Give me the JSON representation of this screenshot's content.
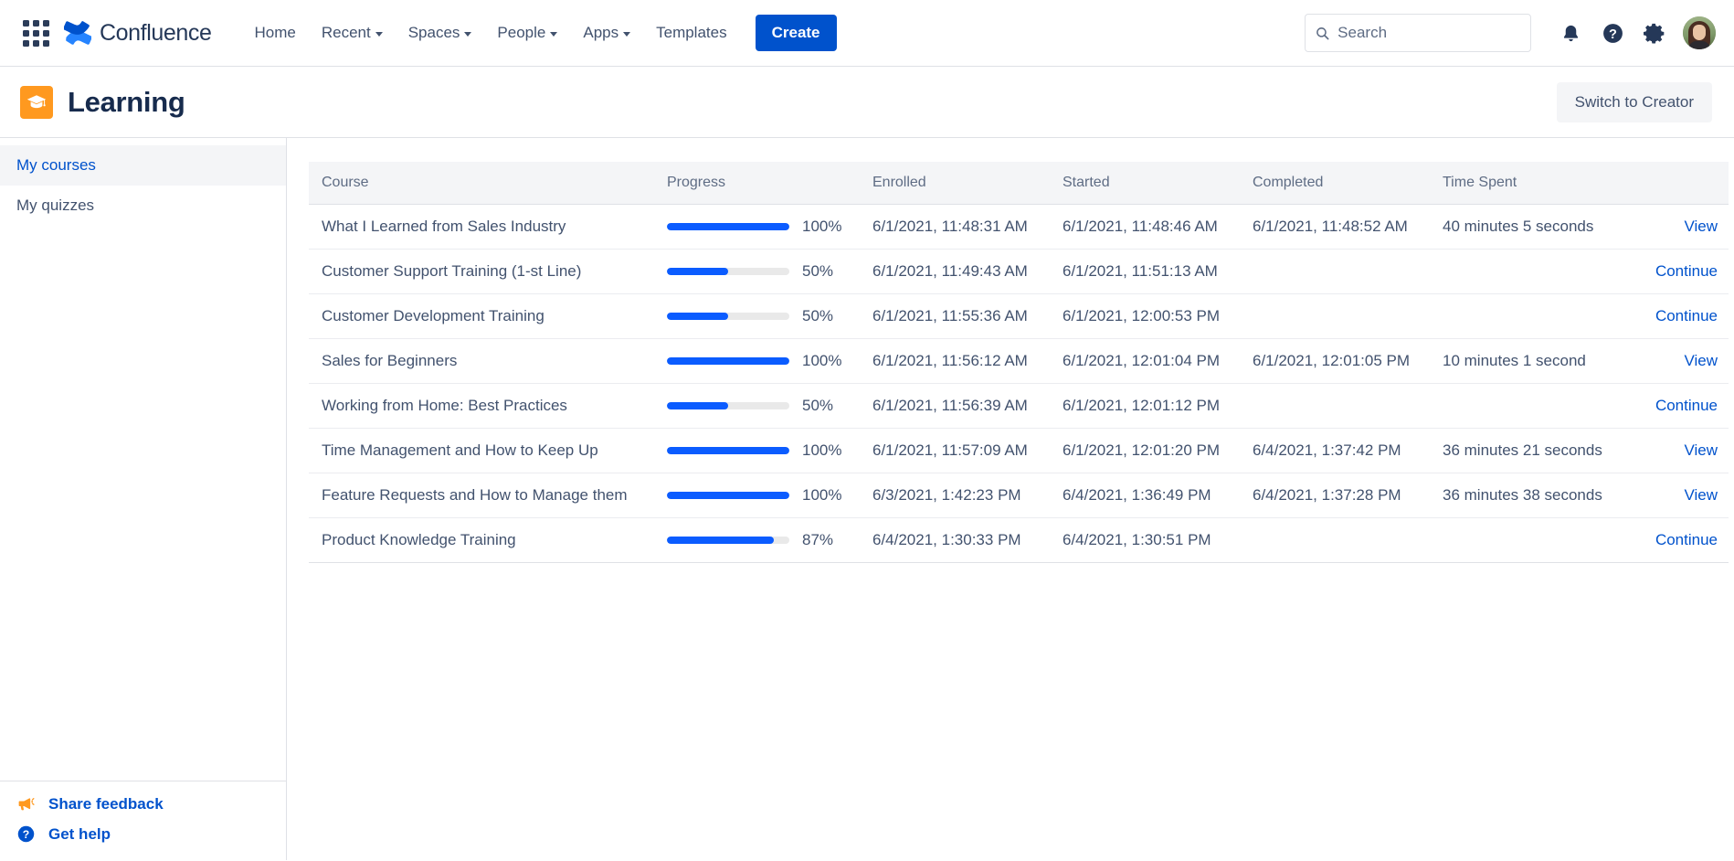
{
  "topnav": {
    "app_switcher_label": "App switcher",
    "brand": "Confluence",
    "links": [
      {
        "label": "Home",
        "has_caret": false
      },
      {
        "label": "Recent",
        "has_caret": true
      },
      {
        "label": "Spaces",
        "has_caret": true
      },
      {
        "label": "People",
        "has_caret": true
      },
      {
        "label": "Apps",
        "has_caret": true
      },
      {
        "label": "Templates",
        "has_caret": false
      }
    ],
    "create_label": "Create",
    "search": {
      "value": "",
      "placeholder": "Search"
    },
    "icons": [
      "notifications-icon",
      "help-icon",
      "settings-icon",
      "avatar"
    ]
  },
  "space": {
    "title": "Learning",
    "logo_icon": "graduation-cap-icon",
    "logo_color": "#ff991f",
    "switch_label": "Switch to Creator"
  },
  "sidebar": {
    "items": [
      {
        "label": "My courses",
        "active": true
      },
      {
        "label": "My quizzes",
        "active": false
      }
    ],
    "footer": [
      {
        "label": "Share feedback",
        "icon": "megaphone-icon"
      },
      {
        "label": "Get help",
        "icon": "question-circle-icon"
      }
    ]
  },
  "colors": {
    "accent": "#0052cc",
    "link": "#0052cc",
    "progress_fill": "#0b5cff",
    "progress_track": "#e9e9e9",
    "header_bg": "#f4f5f7",
    "text": "#42526e",
    "heading": "#172b4d",
    "orange": "#ff991f"
  },
  "table": {
    "columns": [
      "Course",
      "Progress",
      "Enrolled",
      "Started",
      "Completed",
      "Time Spent",
      ""
    ],
    "rows": [
      {
        "course": "What I Learned from Sales Industry",
        "progress": 100,
        "progress_label": "100%",
        "enrolled": "6/1/2021, 11:48:31 AM",
        "started": "6/1/2021, 11:48:46 AM",
        "completed": "6/1/2021, 11:48:52 AM",
        "time_spent": "40 minutes 5 seconds",
        "action": "View"
      },
      {
        "course": "Customer Support Training (1-st Line)",
        "progress": 50,
        "progress_label": "50%",
        "enrolled": "6/1/2021, 11:49:43 AM",
        "started": "6/1/2021, 11:51:13 AM",
        "completed": "",
        "time_spent": "",
        "action": "Continue"
      },
      {
        "course": "Customer Development Training",
        "progress": 50,
        "progress_label": "50%",
        "enrolled": "6/1/2021, 11:55:36 AM",
        "started": "6/1/2021, 12:00:53 PM",
        "completed": "",
        "time_spent": "",
        "action": "Continue"
      },
      {
        "course": "Sales for Beginners",
        "progress": 100,
        "progress_label": "100%",
        "enrolled": "6/1/2021, 11:56:12 AM",
        "started": "6/1/2021, 12:01:04 PM",
        "completed": "6/1/2021, 12:01:05 PM",
        "time_spent": "10 minutes 1 second",
        "action": "View"
      },
      {
        "course": "Working from Home: Best Practices",
        "progress": 50,
        "progress_label": "50%",
        "enrolled": "6/1/2021, 11:56:39 AM",
        "started": "6/1/2021, 12:01:12 PM",
        "completed": "",
        "time_spent": "",
        "action": "Continue"
      },
      {
        "course": "Time Management and How to Keep Up",
        "progress": 100,
        "progress_label": "100%",
        "enrolled": "6/1/2021, 11:57:09 AM",
        "started": "6/1/2021, 12:01:20 PM",
        "completed": "6/4/2021, 1:37:42 PM",
        "time_spent": "36 minutes 21 seconds",
        "action": "View"
      },
      {
        "course": "Feature Requests and How to Manage them",
        "progress": 100,
        "progress_label": "100%",
        "enrolled": "6/3/2021, 1:42:23 PM",
        "started": "6/4/2021, 1:36:49 PM",
        "completed": "6/4/2021, 1:37:28 PM",
        "time_spent": "36 minutes 38 seconds",
        "action": "View"
      },
      {
        "course": "Product Knowledge Training",
        "progress": 87,
        "progress_label": "87%",
        "enrolled": "6/4/2021, 1:30:33 PM",
        "started": "6/4/2021, 1:30:51 PM",
        "completed": "",
        "time_spent": "",
        "action": "Continue"
      }
    ]
  }
}
